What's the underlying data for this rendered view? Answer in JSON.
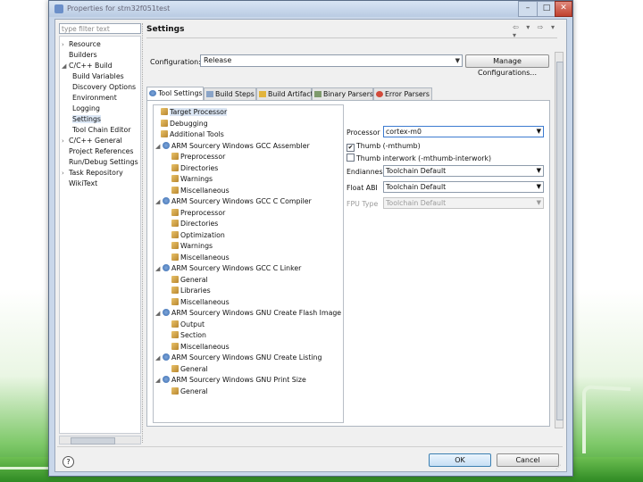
{
  "window": {
    "title": "Properties for stm32f051test"
  },
  "nav": {
    "filter_placeholder": "type filter text",
    "items": [
      {
        "label": "Resource",
        "arrow": "›"
      },
      {
        "label": "Builders",
        "arrow": ""
      },
      {
        "label": "C/C++ Build",
        "arrow": "◢"
      },
      {
        "label": "Build Variables",
        "arrow": ""
      },
      {
        "label": "Discovery Options",
        "arrow": ""
      },
      {
        "label": "Environment",
        "arrow": ""
      },
      {
        "label": "Logging",
        "arrow": ""
      },
      {
        "label": "Settings",
        "arrow": ""
      },
      {
        "label": "Tool Chain Editor",
        "arrow": ""
      },
      {
        "label": "C/C++ General",
        "arrow": "›"
      },
      {
        "label": "Project References",
        "arrow": ""
      },
      {
        "label": "Run/Debug Settings",
        "arrow": ""
      },
      {
        "label": "Task Repository",
        "arrow": "›"
      },
      {
        "label": "WikiText",
        "arrow": ""
      }
    ]
  },
  "page": {
    "title": "Settings",
    "nav_controls": "⇦ ▾ ⇨ ▾ ▾"
  },
  "configuration": {
    "label": "Configuration:",
    "value": "Release",
    "manage_label": "Manage Configurations..."
  },
  "tabs": [
    "Tool Settings",
    "Build Steps",
    "Build Artifact",
    "Binary Parsers",
    "Error Parsers"
  ],
  "tree": [
    {
      "label": "Target Processor"
    },
    {
      "label": "Debugging"
    },
    {
      "label": "Additional Tools"
    },
    {
      "label": "ARM Sourcery Windows GCC Assembler"
    },
    {
      "label": "Preprocessor"
    },
    {
      "label": "Directories"
    },
    {
      "label": "Warnings"
    },
    {
      "label": "Miscellaneous"
    },
    {
      "label": "ARM Sourcery Windows GCC C Compiler"
    },
    {
      "label": "Preprocessor"
    },
    {
      "label": "Directories"
    },
    {
      "label": "Optimization"
    },
    {
      "label": "Warnings"
    },
    {
      "label": "Miscellaneous"
    },
    {
      "label": "ARM Sourcery Windows GCC C Linker"
    },
    {
      "label": "General"
    },
    {
      "label": "Libraries"
    },
    {
      "label": "Miscellaneous"
    },
    {
      "label": "ARM Sourcery Windows GNU Create Flash Image"
    },
    {
      "label": "Output"
    },
    {
      "label": "Section"
    },
    {
      "label": "Miscellaneous"
    },
    {
      "label": "ARM Sourcery Windows GNU Create Listing"
    },
    {
      "label": "General"
    },
    {
      "label": "ARM Sourcery Windows GNU Print Size"
    },
    {
      "label": "General"
    }
  ],
  "options": {
    "processor": {
      "label": "Processor",
      "value": "cortex-m0"
    },
    "thumb": {
      "label": "Thumb (-mthumb)",
      "checked": true,
      "mark": "✔"
    },
    "interwork": {
      "label": "Thumb interwork (-mthumb-interwork)",
      "checked": false
    },
    "endianness": {
      "label": "Endianness",
      "value": "Toolchain Default"
    },
    "float_abi": {
      "label": "Float ABI",
      "value": "Toolchain Default"
    },
    "fpu_type": {
      "label": "FPU Type",
      "value": "Toolchain Default"
    }
  },
  "buttons": {
    "help": "?",
    "ok": "OK",
    "cancel": "Cancel"
  },
  "colors": {
    "accent_green": "#3e9b2e",
    "window_frame": "#c9d7ea",
    "selection": "#dde8f6"
  }
}
